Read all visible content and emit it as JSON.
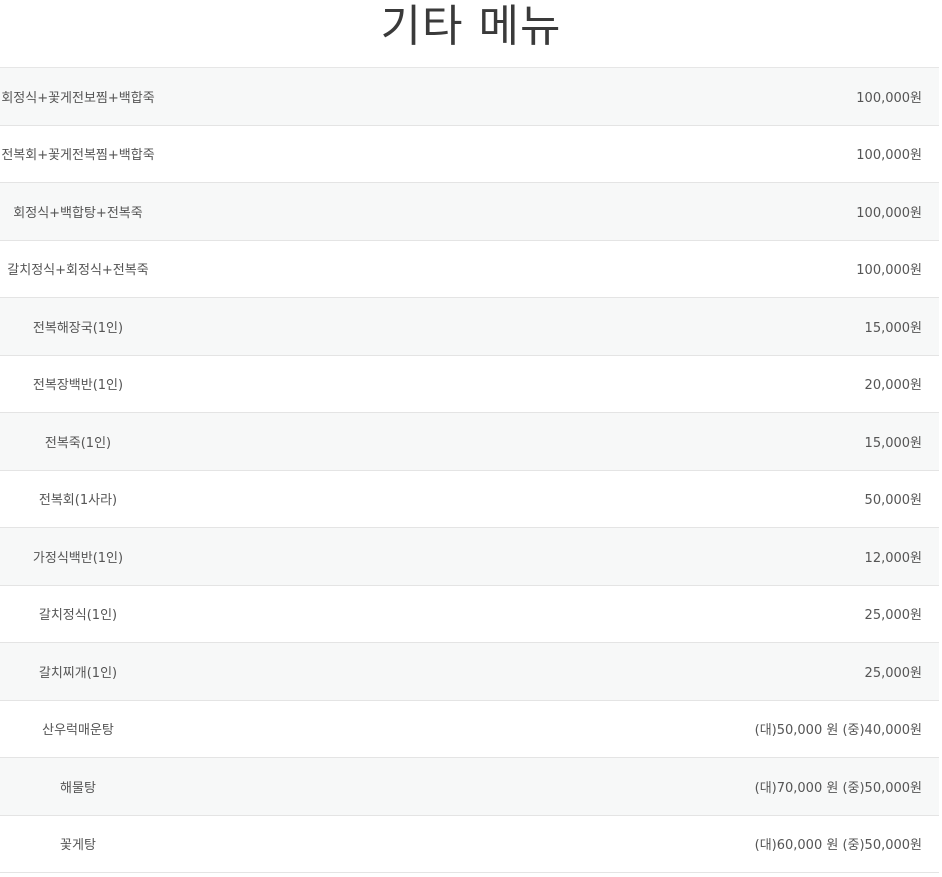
{
  "page": {
    "title": "기타 메뉴"
  },
  "menu": {
    "items": [
      {
        "name": "회정식+꽃게전보찜+백합죽",
        "price": "100,000원"
      },
      {
        "name": "전복회+꽃게전복찜+백합죽",
        "price": "100,000원"
      },
      {
        "name": "회정식+백합탕+전복죽",
        "price": "100,000원"
      },
      {
        "name": "갈치정식+회정식+전복죽",
        "price": "100,000원"
      },
      {
        "name": "전복해장국(1인)",
        "price": "15,000원"
      },
      {
        "name": "전복장백반(1인)",
        "price": "20,000원"
      },
      {
        "name": "전복죽(1인)",
        "price": "15,000원"
      },
      {
        "name": "전복회(1사라)",
        "price": "50,000원"
      },
      {
        "name": "가정식백반(1인)",
        "price": "12,000원"
      },
      {
        "name": "갈치정식(1인)",
        "price": "25,000원"
      },
      {
        "name": "갈치찌개(1인)",
        "price": "25,000원"
      },
      {
        "name": "산우럭매운탕",
        "price": "(대)50,000 원 (중)40,000원"
      },
      {
        "name": "해물탕",
        "price": "(대)70,000 원 (중)50,000원"
      },
      {
        "name": "꽃게탕",
        "price": "(대)60,000 원 (중)50,000원"
      }
    ]
  }
}
